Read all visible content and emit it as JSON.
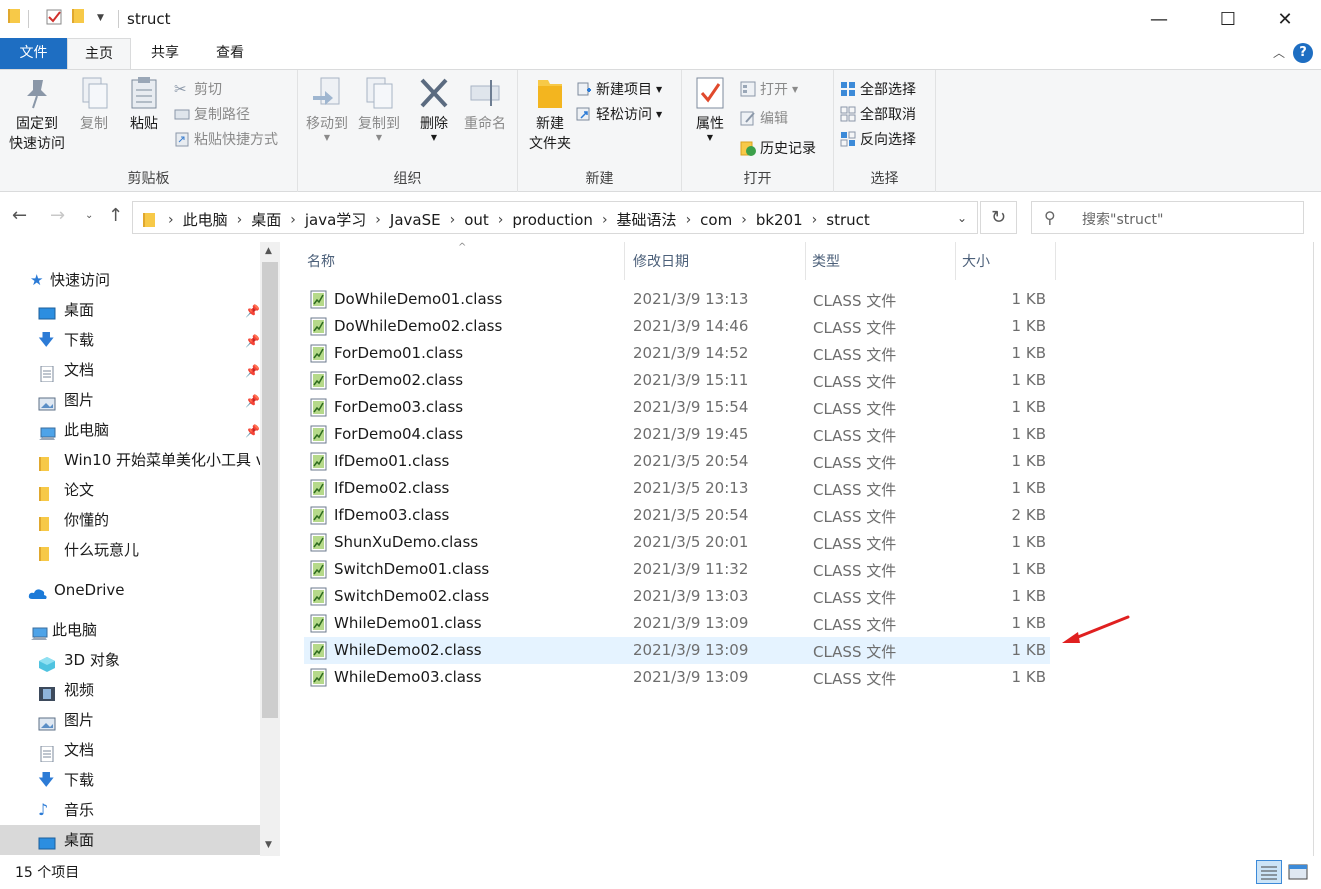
{
  "window": {
    "title": "struct",
    "minimize": "—",
    "maximize": "☐",
    "close": "✕"
  },
  "tabs": {
    "file": "文件",
    "home": "主页",
    "share": "共享",
    "view": "查看",
    "help": "?"
  },
  "ribbon": {
    "clipboard": {
      "label": "剪贴板",
      "pin_line1": "固定到",
      "pin_line2": "快速访问",
      "copy": "复制",
      "paste": "粘贴",
      "cut": "剪切",
      "copy_path": "复制路径",
      "paste_shortcut": "粘贴快捷方式"
    },
    "organize": {
      "label": "组织",
      "move_to": "移动到",
      "copy_to": "复制到",
      "delete": "删除",
      "rename": "重命名"
    },
    "new": {
      "label": "新建",
      "new_folder_line1": "新建",
      "new_folder_line2": "文件夹",
      "new_item": "新建项目",
      "easy_access": "轻松访问"
    },
    "open": {
      "label": "打开",
      "properties": "属性",
      "open": "打开",
      "edit": "编辑",
      "history": "历史记录"
    },
    "select": {
      "label": "选择",
      "select_all": "全部选择",
      "select_none": "全部取消",
      "invert": "反向选择"
    }
  },
  "address": {
    "crumbs": [
      "此电脑",
      "桌面",
      "java学习",
      "JavaSE",
      "out",
      "production",
      "基础语法",
      "com",
      "bk201",
      "struct"
    ],
    "search_placeholder": "搜索\"struct\""
  },
  "nav": {
    "quick_access": "快速访问",
    "items": [
      {
        "label": "桌面",
        "icon": "desktop-icon",
        "pinned": true
      },
      {
        "label": "下载",
        "icon": "download-icon",
        "pinned": true
      },
      {
        "label": "文档",
        "icon": "document-icon",
        "pinned": true
      },
      {
        "label": "图片",
        "icon": "picture-icon",
        "pinned": true
      },
      {
        "label": "此电脑",
        "icon": "computer-icon",
        "pinned": true
      },
      {
        "label": "Win10 开始菜单美化小工具 v",
        "icon": "folder-icon",
        "pinned": false
      },
      {
        "label": "论文",
        "icon": "folder-icon",
        "pinned": false
      },
      {
        "label": "你懂的",
        "icon": "folder-icon",
        "pinned": false
      },
      {
        "label": "什么玩意儿",
        "icon": "folder-icon",
        "pinned": false
      }
    ],
    "onedrive": "OneDrive",
    "this_pc": "此电脑",
    "pc_items": [
      {
        "label": "3D 对象",
        "icon": "3d-objects-icon"
      },
      {
        "label": "视频",
        "icon": "video-icon"
      },
      {
        "label": "图片",
        "icon": "picture-icon"
      },
      {
        "label": "文档",
        "icon": "document-icon"
      },
      {
        "label": "下载",
        "icon": "download-icon"
      },
      {
        "label": "音乐",
        "icon": "music-icon"
      },
      {
        "label": "桌面",
        "icon": "desktop-icon"
      }
    ]
  },
  "columns": {
    "name": "名称",
    "date": "修改日期",
    "type": "类型",
    "size": "大小"
  },
  "files": [
    {
      "name": "DoWhileDemo01.class",
      "date": "2021/3/9 13:13",
      "type": "CLASS 文件",
      "size": "1 KB"
    },
    {
      "name": "DoWhileDemo02.class",
      "date": "2021/3/9 14:46",
      "type": "CLASS 文件",
      "size": "1 KB"
    },
    {
      "name": "ForDemo01.class",
      "date": "2021/3/9 14:52",
      "type": "CLASS 文件",
      "size": "1 KB"
    },
    {
      "name": "ForDemo02.class",
      "date": "2021/3/9 15:11",
      "type": "CLASS 文件",
      "size": "1 KB"
    },
    {
      "name": "ForDemo03.class",
      "date": "2021/3/9 15:54",
      "type": "CLASS 文件",
      "size": "1 KB"
    },
    {
      "name": "ForDemo04.class",
      "date": "2021/3/9 19:45",
      "type": "CLASS 文件",
      "size": "1 KB"
    },
    {
      "name": "IfDemo01.class",
      "date": "2021/3/5 20:54",
      "type": "CLASS 文件",
      "size": "1 KB"
    },
    {
      "name": "IfDemo02.class",
      "date": "2021/3/5 20:13",
      "type": "CLASS 文件",
      "size": "1 KB"
    },
    {
      "name": "IfDemo03.class",
      "date": "2021/3/5 20:54",
      "type": "CLASS 文件",
      "size": "2 KB"
    },
    {
      "name": "ShunXuDemo.class",
      "date": "2021/3/5 20:01",
      "type": "CLASS 文件",
      "size": "1 KB"
    },
    {
      "name": "SwitchDemo01.class",
      "date": "2021/3/9 11:32",
      "type": "CLASS 文件",
      "size": "1 KB"
    },
    {
      "name": "SwitchDemo02.class",
      "date": "2021/3/9 13:03",
      "type": "CLASS 文件",
      "size": "1 KB"
    },
    {
      "name": "WhileDemo01.class",
      "date": "2021/3/9 13:09",
      "type": "CLASS 文件",
      "size": "1 KB"
    },
    {
      "name": "WhileDemo02.class",
      "date": "2021/3/9 13:09",
      "type": "CLASS 文件",
      "size": "1 KB",
      "selected": true
    },
    {
      "name": "WhileDemo03.class",
      "date": "2021/3/9 13:09",
      "type": "CLASS 文件",
      "size": "1 KB"
    }
  ],
  "status": {
    "count": "15 个项目"
  },
  "colors": {
    "accent": "#1e6ec2",
    "selection": "#e5f3ff",
    "annotation_arrow": "#e02020"
  }
}
